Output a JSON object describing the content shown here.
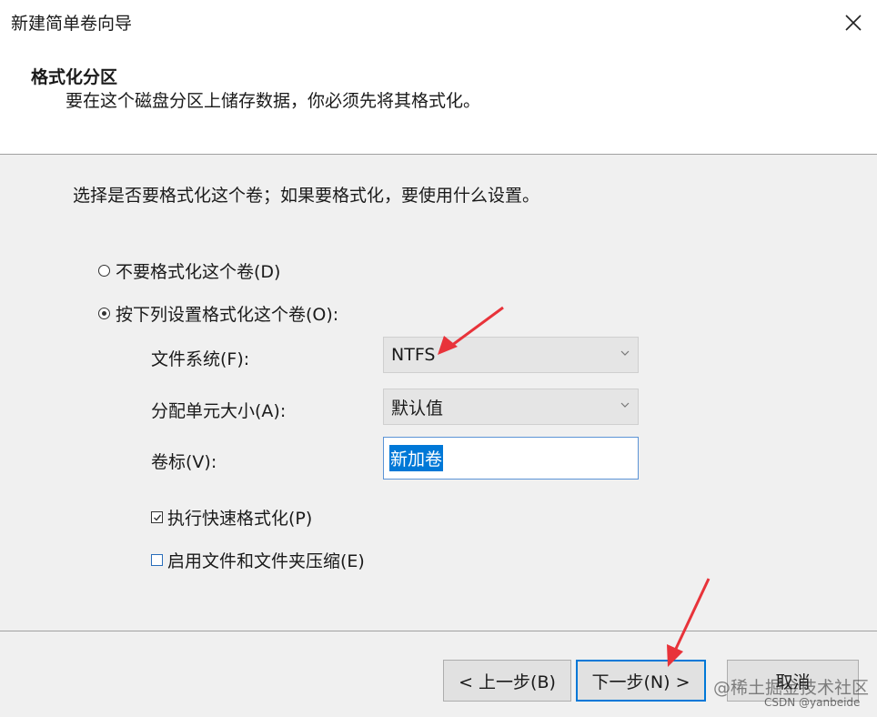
{
  "window": {
    "title": "新建简单卷向导",
    "close_icon": "close-icon"
  },
  "header": {
    "title": "格式化分区",
    "subtitle": "要在这个磁盘分区上储存数据，你必须先将其格式化。"
  },
  "main": {
    "instruction": "选择是否要格式化这个卷；如果要格式化，要使用什么设置。",
    "option_no_format": {
      "label": "不要格式化这个卷(D)",
      "selected": false
    },
    "option_format": {
      "label": "按下列设置格式化这个卷(O):",
      "selected": true
    },
    "file_system": {
      "label": "文件系统(F):",
      "value": "NTFS"
    },
    "allocation_unit": {
      "label": "分配单元大小(A):",
      "value": "默认值"
    },
    "volume_label": {
      "label": "卷标(V):",
      "value": "新加卷"
    },
    "quick_format": {
      "label": "执行快速格式化(P)",
      "checked": true
    },
    "compression": {
      "label": "启用文件和文件夹压缩(E)",
      "checked": false
    }
  },
  "footer": {
    "back_label": "< 上一步(B)",
    "next_label": "下一步(N) >",
    "cancel_label": "取消"
  },
  "watermark": {
    "text": "@稀土掘金技术社区",
    "sub": "CSDN @yanbeide"
  },
  "colors": {
    "accent": "#0078d7",
    "annotation_arrow": "#e8333a"
  }
}
